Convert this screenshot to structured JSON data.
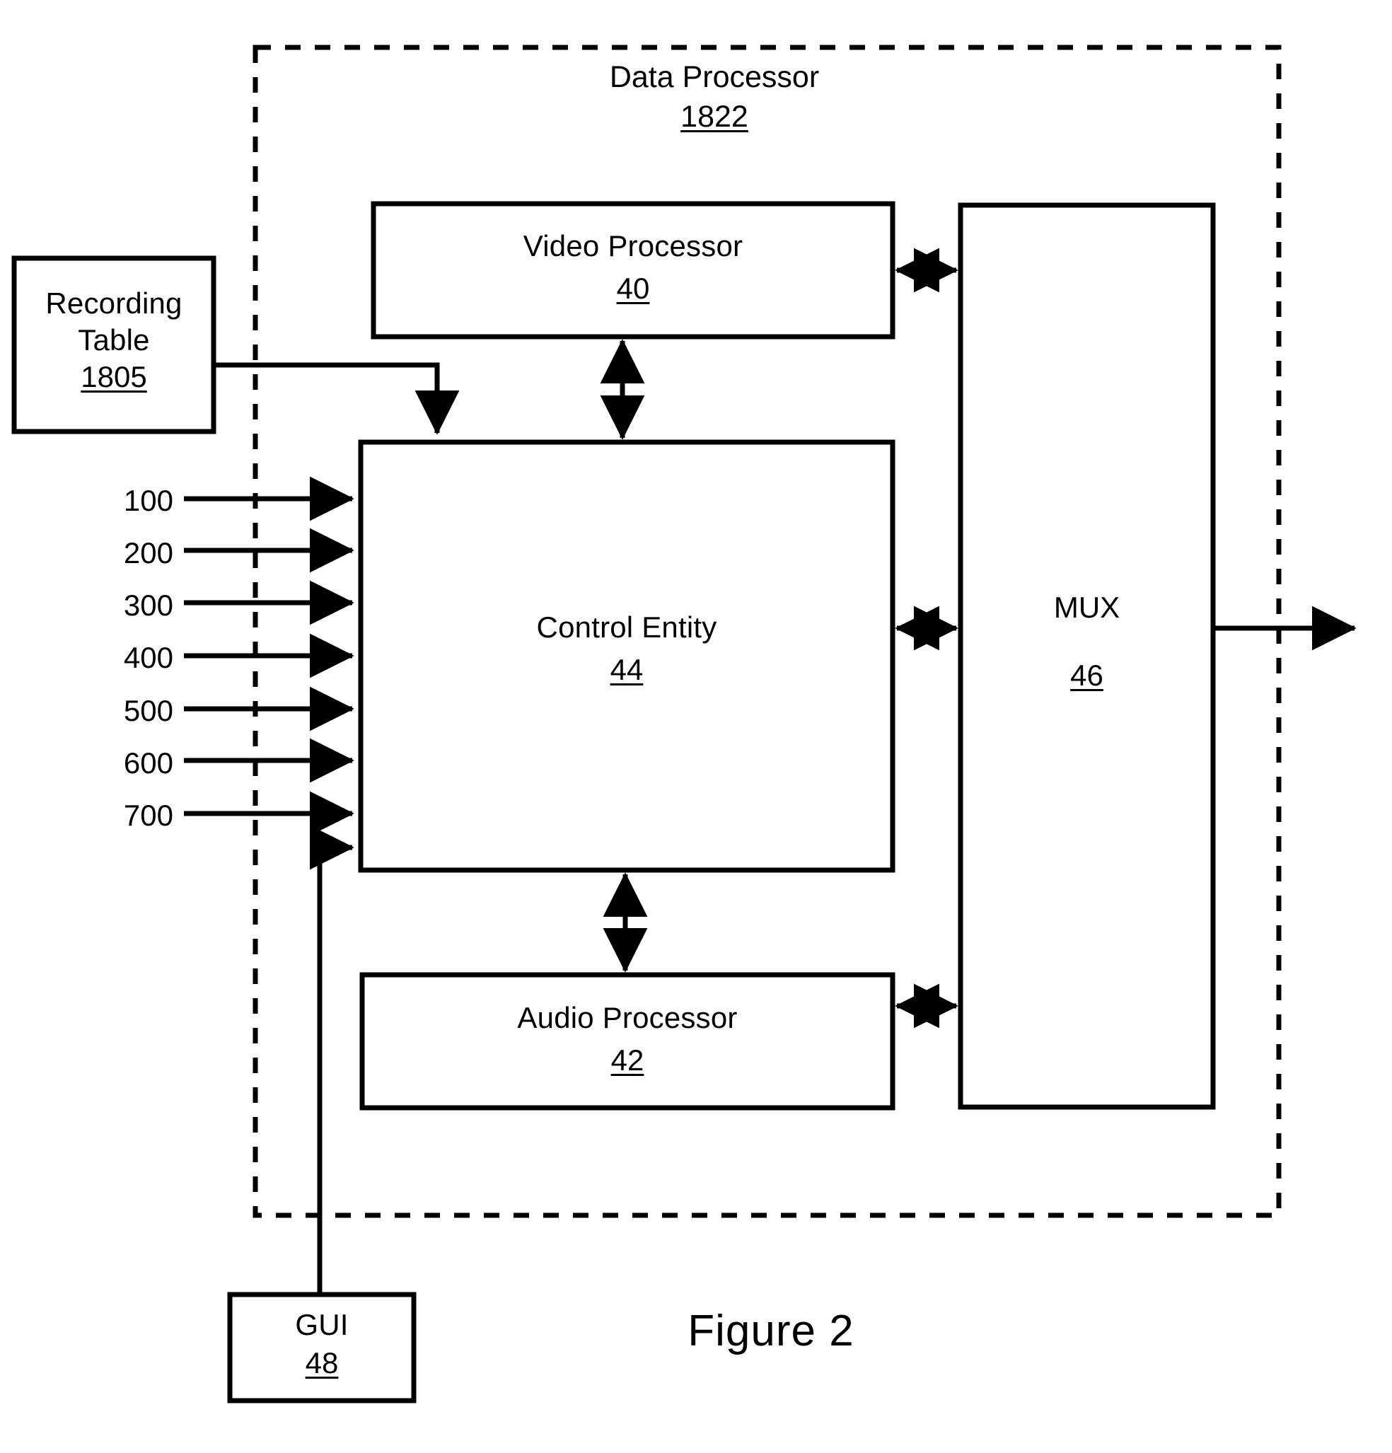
{
  "figure": {
    "caption": "Figure 2"
  },
  "outer_container": {
    "name": "Data Processor",
    "title": "Data Processor",
    "ref": "1822",
    "border_style": "dashed",
    "color": "#000000"
  },
  "boxes": [
    {
      "id": "recording-table",
      "title_line1": "Recording",
      "title_line2": "Table",
      "ref": "1805"
    },
    {
      "id": "video-processor",
      "title": "Video Processor",
      "ref": "40"
    },
    {
      "id": "control-entity",
      "title": "Control Entity",
      "ref": "44"
    },
    {
      "id": "mux",
      "title": "MUX",
      "ref": "46"
    },
    {
      "id": "audio-processor",
      "title": "Audio Processor",
      "ref": "42"
    },
    {
      "id": "gui",
      "title": "GUI",
      "ref": "48"
    }
  ],
  "signal_inputs": {
    "labels": [
      "100",
      "200",
      "300",
      "400",
      "500",
      "600",
      "700"
    ]
  },
  "colors": {
    "stroke": "#000000",
    "background": "#ffffff"
  }
}
